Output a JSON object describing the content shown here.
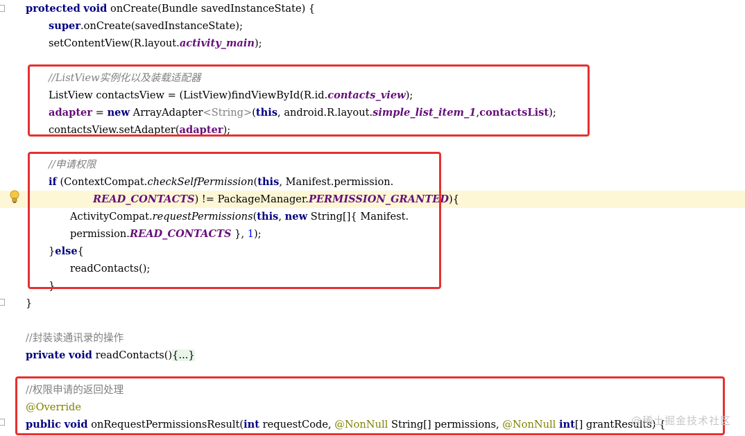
{
  "lines": [
    {
      "tokens": [
        {
          "t": "protected",
          "c": "kw"
        },
        {
          "t": " "
        },
        {
          "t": "void",
          "c": "kw"
        },
        {
          "t": " onCreate(Bundle savedInstanceState) {"
        }
      ]
    },
    {
      "tokens": [
        {
          "t": "super",
          "c": "kw"
        },
        {
          "t": ".onCreate(savedInstanceState);"
        }
      ]
    },
    {
      "tokens": [
        {
          "t": "setContentView(R.layout."
        },
        {
          "t": "activity_main",
          "c": "fi"
        },
        {
          "t": ");"
        }
      ]
    },
    {
      "tokens": []
    },
    {
      "tokens": [
        {
          "t": "//ListView实例化以及装载适配器",
          "c": "cmi"
        }
      ]
    },
    {
      "tokens": [
        {
          "t": "ListView contactsView = (ListView)findViewById(R.id."
        },
        {
          "t": "contacts_view",
          "c": "fi"
        },
        {
          "t": ");"
        }
      ]
    },
    {
      "tokens": [
        {
          "t": "adapter",
          "c": "fld"
        },
        {
          "t": " = "
        },
        {
          "t": "new",
          "c": "kw"
        },
        {
          "t": " ArrayAdapter"
        },
        {
          "t": "<String>",
          "c": "gen"
        },
        {
          "t": "("
        },
        {
          "t": "this",
          "c": "kw"
        },
        {
          "t": ", android.R.layout."
        },
        {
          "t": "simple_list_item_1",
          "c": "fi"
        },
        {
          "t": ","
        },
        {
          "t": "contactsList",
          "c": "fld"
        },
        {
          "t": ");"
        }
      ]
    },
    {
      "tokens": [
        {
          "t": "contactsView.setAdapter("
        },
        {
          "t": "adapter",
          "c": "fld"
        },
        {
          "t": ");"
        }
      ]
    },
    {
      "tokens": []
    },
    {
      "tokens": [
        {
          "t": "//申请权限",
          "c": "cmi"
        }
      ]
    },
    {
      "tokens": [
        {
          "t": "if",
          "c": "kw"
        },
        {
          "t": " (ContextCompat."
        },
        {
          "t": "checkSelfPermission",
          "c": "mi"
        },
        {
          "t": "("
        },
        {
          "t": "this",
          "c": "kw"
        },
        {
          "t": ", Manifest.permission."
        }
      ]
    },
    {
      "tokens": [
        {
          "t": "READ_CONTACTS",
          "c": "fi"
        },
        {
          "t": ") != PackageManager."
        },
        {
          "t": "PERMISSION_GRANTED",
          "c": "fi"
        },
        {
          "t": "){"
        }
      ]
    },
    {
      "tokens": [
        {
          "t": "ActivityCompat."
        },
        {
          "t": "requestPermissions",
          "c": "mi"
        },
        {
          "t": "("
        },
        {
          "t": "this",
          "c": "kw"
        },
        {
          "t": ", "
        },
        {
          "t": "new",
          "c": "kw"
        },
        {
          "t": " String[]{ Manifest."
        }
      ]
    },
    {
      "tokens": [
        {
          "t": "permission."
        },
        {
          "t": "READ_CONTACTS",
          "c": "fi"
        },
        {
          "t": " }, "
        },
        {
          "t": "1",
          "c": "num"
        },
        {
          "t": ");"
        }
      ]
    },
    {
      "tokens": [
        {
          "t": "}"
        },
        {
          "t": "else",
          "c": "kw"
        },
        {
          "t": "{"
        }
      ]
    },
    {
      "tokens": [
        {
          "t": "readContacts();"
        }
      ]
    },
    {
      "tokens": [
        {
          "t": "}"
        }
      ]
    },
    {
      "tokens": [
        {
          "t": "}"
        }
      ]
    },
    {
      "tokens": []
    },
    {
      "tokens": [
        {
          "t": "//封装读通讯录的操作",
          "c": "cm"
        }
      ]
    },
    {
      "tokens": [
        {
          "t": "private",
          "c": "kw"
        },
        {
          "t": " "
        },
        {
          "t": "void",
          "c": "kw"
        },
        {
          "t": " readContacts()"
        },
        {
          "t": "{...}",
          "c": "fold"
        }
      ]
    },
    {
      "tokens": []
    },
    {
      "tokens": [
        {
          "t": "//权限申请的返回处理",
          "c": "cm"
        }
      ]
    },
    {
      "tokens": [
        {
          "t": "@Override",
          "c": "ann"
        }
      ]
    },
    {
      "tokens": [
        {
          "t": "public",
          "c": "kw"
        },
        {
          "t": " "
        },
        {
          "t": "void",
          "c": "kw"
        },
        {
          "t": " onRequestPermissionsResult("
        },
        {
          "t": "int",
          "c": "kw"
        },
        {
          "t": " requestCode, "
        },
        {
          "t": "@NonNull",
          "c": "ann"
        },
        {
          "t": " String[] permissions, "
        },
        {
          "t": "@NonNull",
          "c": "ann"
        },
        {
          "t": " "
        },
        {
          "t": "int",
          "c": "kw"
        },
        {
          "t": "[] grantResults) {"
        }
      ]
    }
  ],
  "watermark": "@稀土掘金技术社区",
  "colors": {
    "keyword": "#000080",
    "field": "#660e7a",
    "comment": "#808080",
    "annotation": "#808000",
    "number": "#0000ff",
    "highlight_box": "#e53030"
  },
  "icons": {
    "intention": "lightbulb-icon"
  }
}
